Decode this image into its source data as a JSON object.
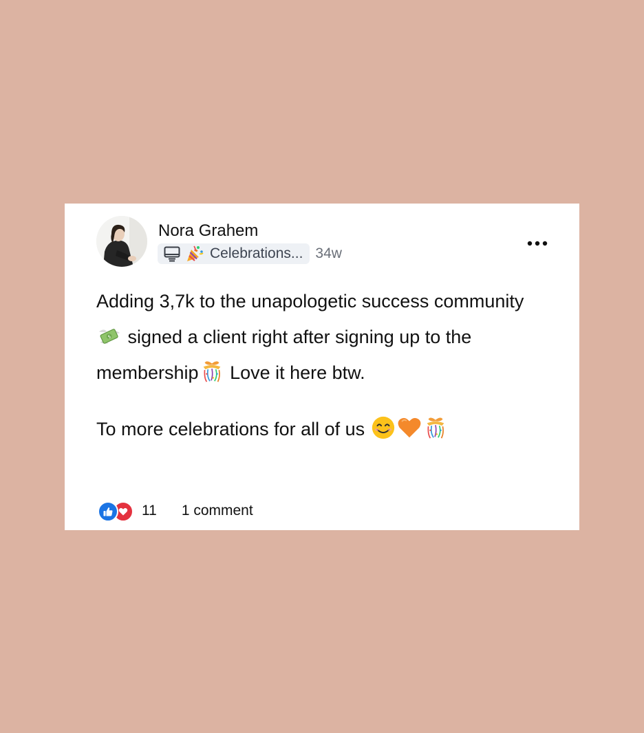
{
  "post": {
    "author": "Nora Grahem",
    "group": "Celebrations...",
    "time": "34w",
    "paragraphs": {
      "p1": {
        "part1": "Adding 3,7k to the unapologetic success community ",
        "part2": " signed a client right after signing up to the membership",
        "part3": " Love it here btw."
      },
      "p2": {
        "part1": "To more celebrations for all of us "
      }
    },
    "reaction_count": "11",
    "comments_label": "1 comment"
  },
  "icons": {
    "group_type": "monitor-icon",
    "group_emoji": "party-popper-icon",
    "more": "more-options-icon",
    "money": "money-with-wings-icon",
    "confetti": "confetti-ball-icon",
    "smile": "smiling-face-icon",
    "heart": "orange-heart-icon",
    "like": "like-reaction-icon",
    "love": "love-reaction-icon"
  },
  "colors": {
    "background": "#dcb3a2",
    "card": "#ffffff",
    "like_blue": "#1b74e4",
    "love_red": "#e4323f",
    "heart_orange": "#f4892b"
  }
}
